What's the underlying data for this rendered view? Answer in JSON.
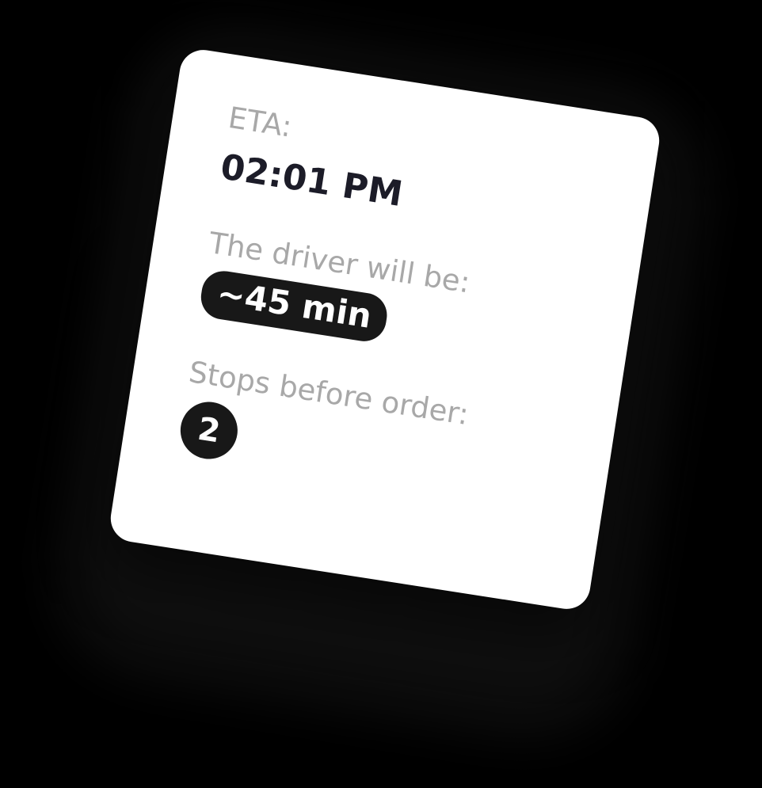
{
  "card": {
    "eta_label": "ETA:",
    "eta_value": "02:01 PM",
    "driver_label": "The driver will be:",
    "driver_value": "~45 min",
    "stops_label": "Stops before order:",
    "stops_value": "2"
  },
  "colors": {
    "background": "#000000",
    "card": "#ffffff",
    "label": "#a8a8a8",
    "value": "#1c1c28",
    "badge": "#181818"
  }
}
